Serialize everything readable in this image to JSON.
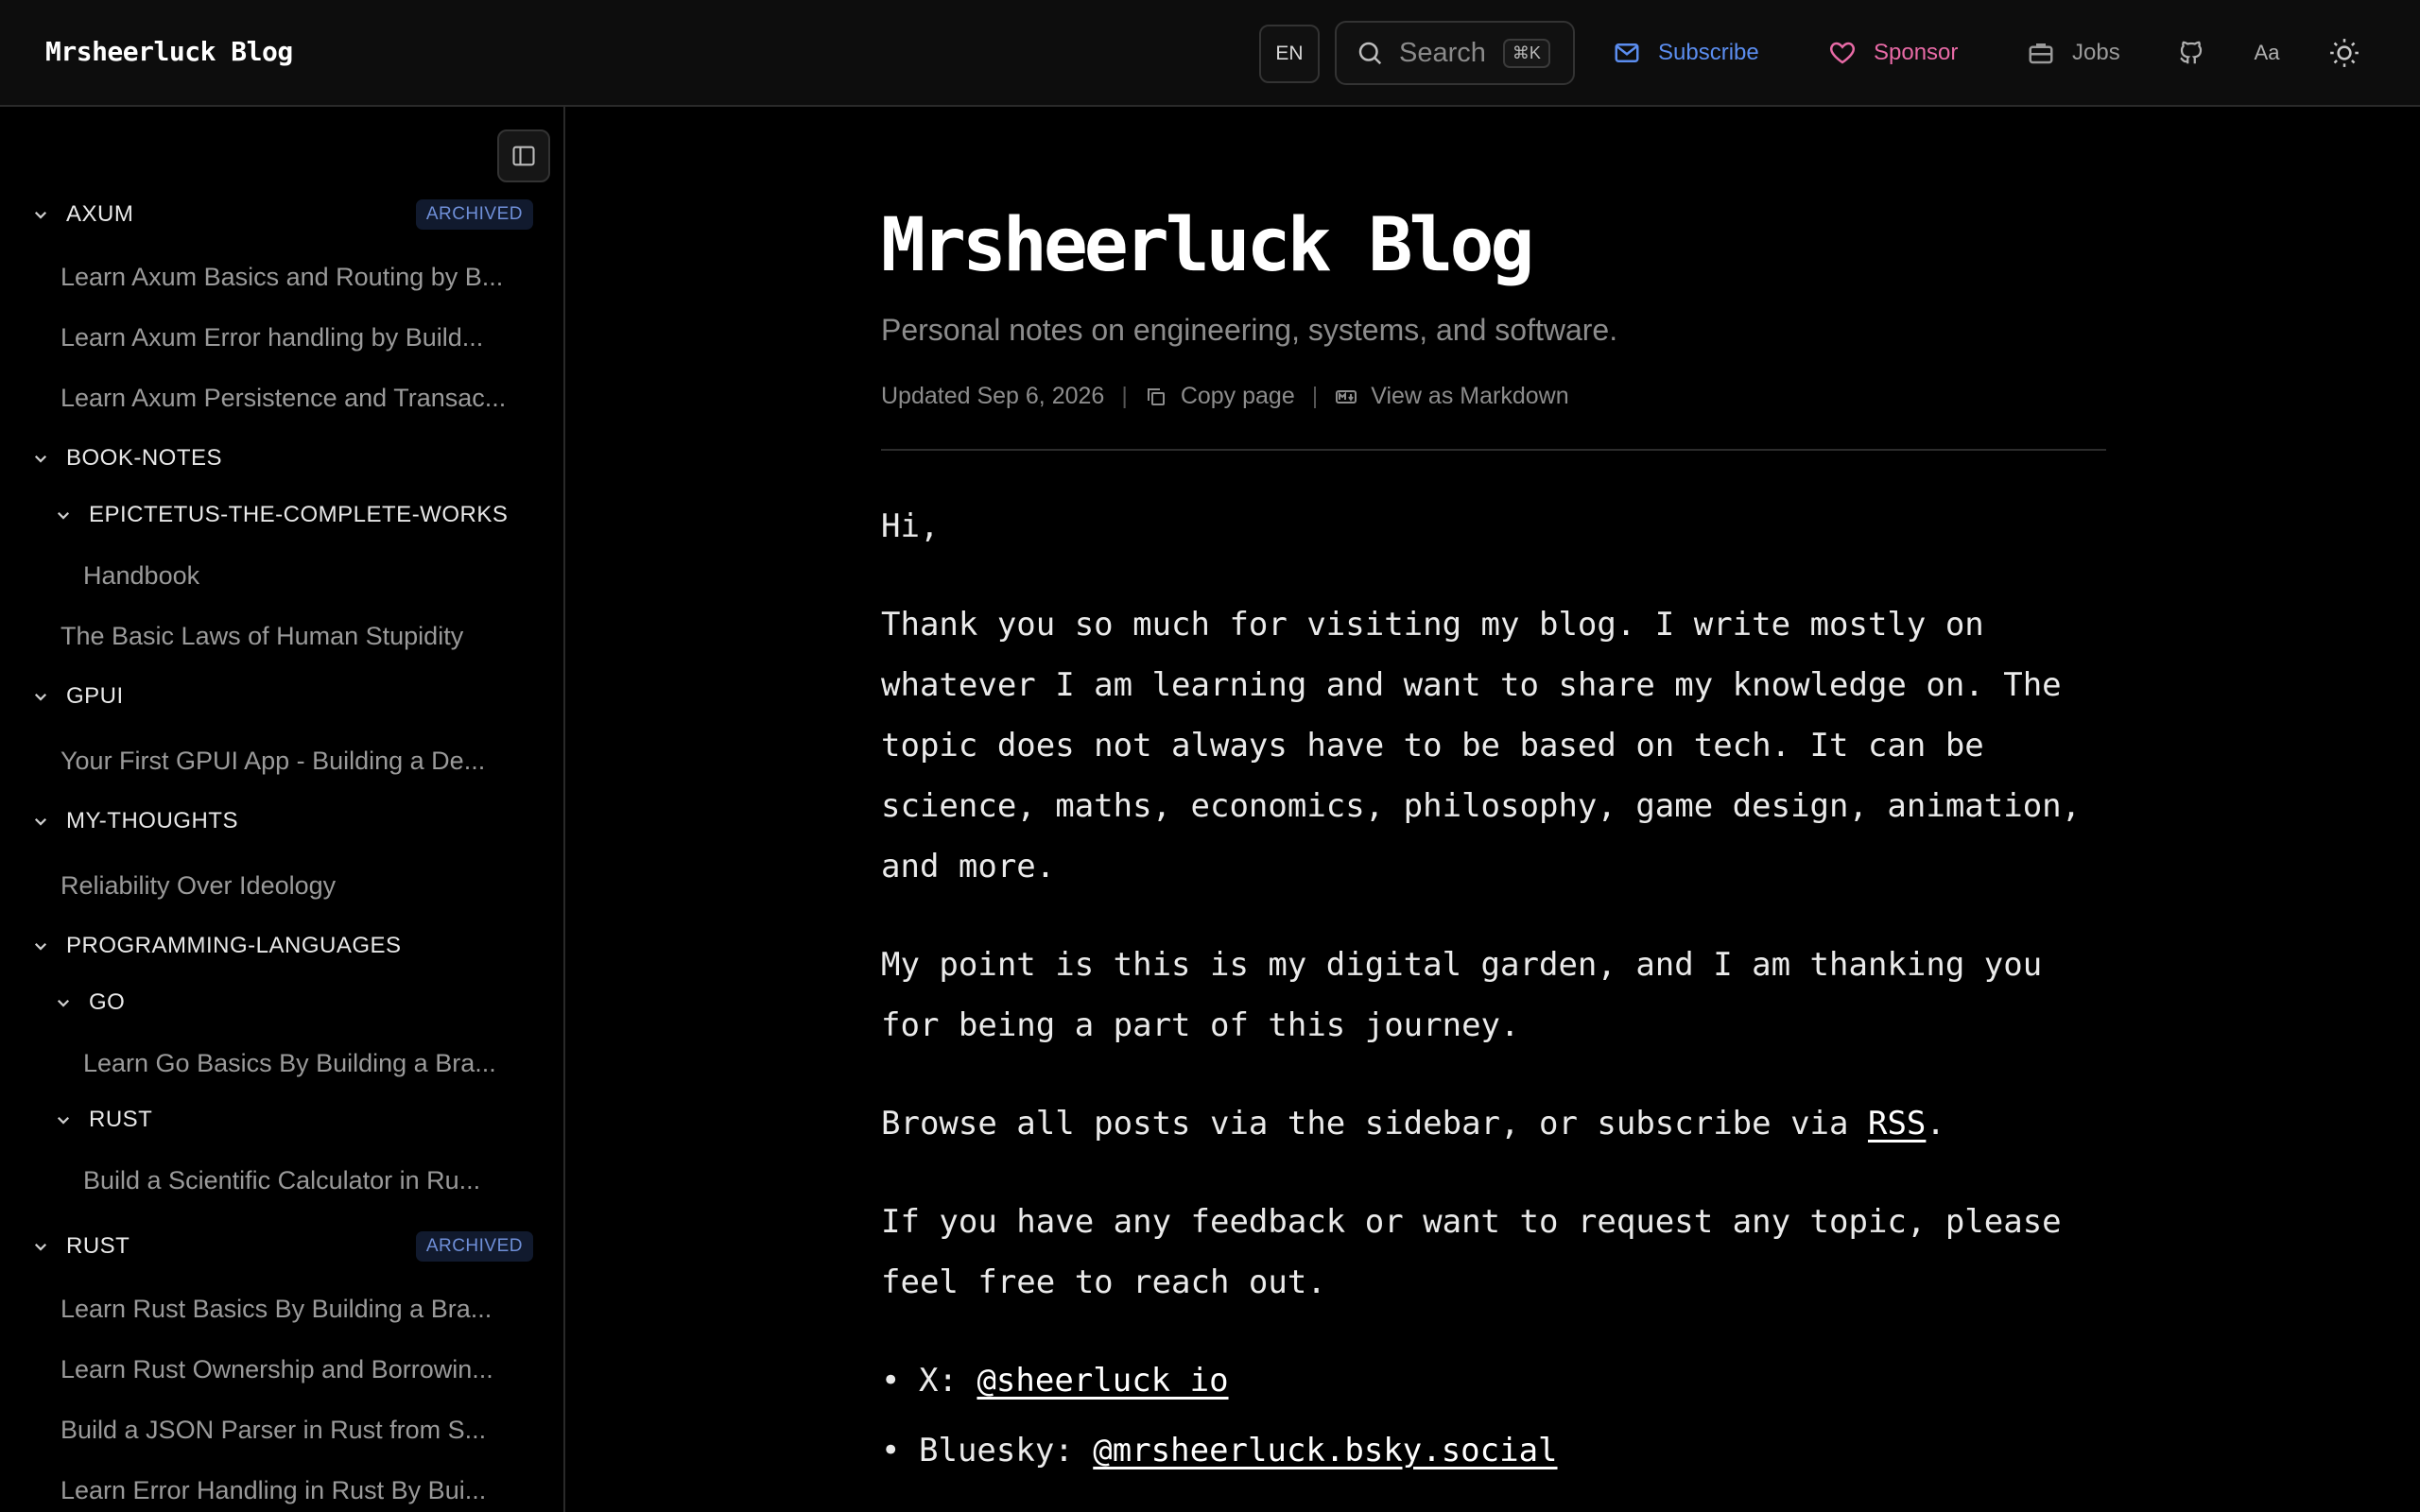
{
  "header": {
    "brand": "Mrsheerluck Blog",
    "lang": "EN",
    "search_placeholder": "Search",
    "search_shortcut": "⌘K",
    "subscribe": "Subscribe",
    "sponsor": "Sponsor",
    "jobs": "Jobs",
    "font_toggle": "Aa"
  },
  "colors": {
    "subscribe": "#5b8def",
    "sponsor": "#e86aa6",
    "badge_text": "#6f8fd8"
  },
  "sidebar": {
    "axum": {
      "label": "AXUM",
      "badge": "ARCHIVED",
      "items": [
        "Learn Axum Basics and Routing by B...",
        "Learn Axum Error handling by Build...",
        "Learn Axum Persistence and Transac..."
      ]
    },
    "book_notes": {
      "label": "BOOK-NOTES",
      "epictetus": "EPICTETUS-THE-COMPLETE-WORKS",
      "handbook": "Handbook",
      "stupidity": "The Basic Laws of Human Stupidity"
    },
    "gpui": {
      "label": "GPUI",
      "item": "Your First GPUI App - Building a De..."
    },
    "my_thoughts": {
      "label": "MY-THOUGHTS",
      "item": "Reliability Over Ideology"
    },
    "programming": {
      "label": "PROGRAMMING-LANGUAGES",
      "go": "GO",
      "go_item": "Learn Go Basics By Building a Bra...",
      "rust": "RUST",
      "rust_item": "Build a Scientific Calculator in Ru..."
    },
    "rust": {
      "label": "RUST",
      "badge": "ARCHIVED",
      "items": [
        "Learn Rust Basics By Building a Bra...",
        "Learn Rust Ownership and Borrowin...",
        "Build a JSON Parser in Rust from S...",
        "Learn Error Handling in Rust By Bui..."
      ]
    }
  },
  "main": {
    "title": "Mrsheerluck Blog",
    "subtitle": "Personal notes on engineering, systems, and software.",
    "updated": "Updated Sep 6, 2026",
    "copy_page": "Copy page",
    "view_markdown": "View as Markdown",
    "greeting": "Hi,",
    "para1": "Thank you so much for visiting my blog. I write mostly on whatever I am learning and want to share my knowledge on. The topic does not always have to be based on tech. It can be science, maths, economics, philosophy, game design, animation, and more.",
    "para2": "My point is this is my digital garden, and I am thanking you for being a part of this journey.",
    "para3_before": "Browse all posts via the sidebar, or subscribe via ",
    "para3_link": "RSS",
    "para3_after": ".",
    "para4": "If you have any feedback or want to request any topic, please feel free to reach out.",
    "social_x_label": "X: ",
    "social_x_handle": "@sheerluck_io",
    "social_bsky_label": "Bluesky: ",
    "social_bsky_handle": "@mrsheerluck.bsky.social"
  }
}
